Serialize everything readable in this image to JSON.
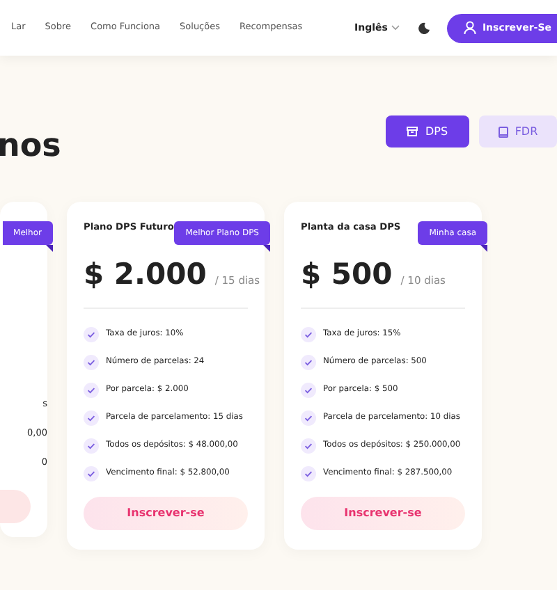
{
  "nav": {
    "links": [
      "Lar",
      "Sobre",
      "Como Funciona",
      "Soluções",
      "Recompensas"
    ],
    "language": "Inglês",
    "signup": "Inscrever-Se"
  },
  "heading": "nos",
  "plan_tabs": [
    {
      "label": "DPS",
      "selected": true
    },
    {
      "label": "FDR",
      "selected": false
    }
  ],
  "plans": [
    {
      "kind": "clipped",
      "badge": "Melhor",
      "features": [
        "s",
        "0,00",
        "0"
      ]
    },
    {
      "kind": "full",
      "title": "Plano DPS Futuro",
      "badge": "Melhor Plano DPS",
      "price": "$ 2.000",
      "period": "/ 15 dias",
      "features": [
        "Taxa de juros: 10%",
        "Número de parcelas: 24",
        "Por parcela: $ 2.000",
        "Parcela de parcelamento: 15 dias",
        "Todos os depósitos: $ 48.000,00",
        "Vencimento final: $ 52.800,00"
      ],
      "button": "Inscrever-se"
    },
    {
      "kind": "full",
      "title": "Planta da casa DPS",
      "badge": "Minha casa",
      "price": "$ 500",
      "period": "/ 10 dias",
      "features": [
        "Taxa de juros: 15%",
        "Número de parcelas: 500",
        "Por parcela: $ 500",
        "Parcela de parcelamento: 10 dias",
        "Todos os depósitos: $ 250.000,00",
        "Vencimento final: $ 287.500,00"
      ],
      "button": "Inscrever-se"
    }
  ]
}
